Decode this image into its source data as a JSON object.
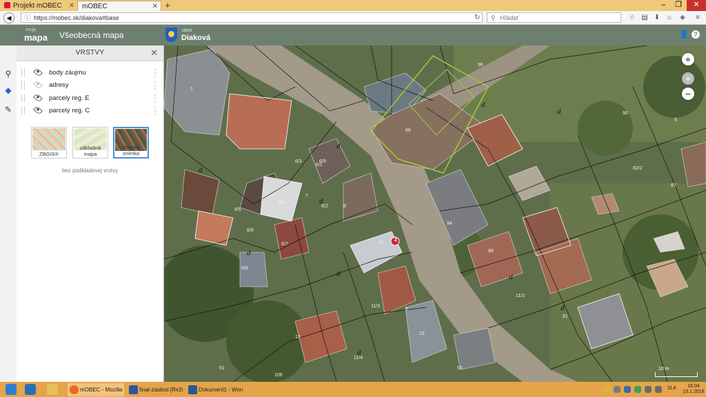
{
  "browser": {
    "tabs": [
      {
        "label": "Projekt mOBEC",
        "active": false
      },
      {
        "label": "mOBEC",
        "active": true
      }
    ],
    "url": "https://mobec.sk/diakova#base",
    "search_placeholder": "Hľadať",
    "window_buttons": [
      "–",
      "❐",
      "✕"
    ]
  },
  "app": {
    "logo_small": "moja",
    "logo_big": "mapa",
    "title": "Všeobecná mapa",
    "municipality_prefix": "obec",
    "municipality_name": "Diaková"
  },
  "panel": {
    "title": "VRSTVY",
    "layers": [
      {
        "label": "body záujmu",
        "visible": true
      },
      {
        "label": "adresy",
        "visible": false
      },
      {
        "label": "parcely reg. E",
        "visible": true
      },
      {
        "label": "parcely reg. C",
        "visible": true
      }
    ],
    "basemaps": [
      {
        "label": "ZBGIS®",
        "selected": false
      },
      {
        "label": "základná mapa",
        "selected": false
      },
      {
        "label": "letecká snímka",
        "selected": true
      }
    ],
    "no_base_label": "bez podkladovej vrstvy"
  },
  "map": {
    "parcel_labels": [
      "1",
      "2",
      "5",
      "6/1",
      "6/2",
      "6/3",
      "6/4",
      "6/5",
      "6/6",
      "6/7",
      "6/8",
      "6/9",
      "7",
      "8",
      "10",
      "11/3",
      "11/4",
      "12",
      "13",
      "50",
      "61",
      "81",
      "82/2",
      "86",
      "87",
      "89",
      "90",
      "94",
      "96",
      "106",
      "11/2"
    ],
    "d_label": "d",
    "marker_count": "2",
    "scale_label": "10 m"
  },
  "taskbar": {
    "items": [
      {
        "label": "mOBEC - Mozilla ..."
      },
      {
        "label": "final-ziadost [Reži..."
      },
      {
        "label": "Dokument1 - Word"
      }
    ],
    "language": "SLK",
    "time": "16:04",
    "date": "23.1.2018"
  },
  "colors": {
    "app_header": "#6d8070",
    "tab_bar": "#f0c87a",
    "taskbar": "#e6a44a",
    "selection_green": "#a7c93a"
  }
}
